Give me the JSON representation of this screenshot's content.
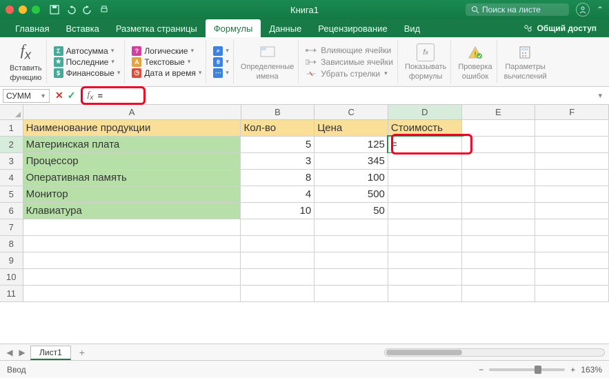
{
  "titlebar": {
    "title": "Книга1",
    "search_placeholder": "Поиск на листе"
  },
  "tabs": {
    "home": "Главная",
    "insert": "Вставка",
    "layout": "Разметка страницы",
    "formulas": "Формулы",
    "data": "Данные",
    "review": "Рецензирование",
    "view": "Вид",
    "share": "Общий доступ"
  },
  "ribbon": {
    "insert_fn": "Вставить",
    "insert_fn2": "функцию",
    "autosum": "Автосумма",
    "recent": "Последние",
    "financial": "Финансовые",
    "logical": "Логические",
    "text": "Текстовые",
    "datetime": "Дата и время",
    "defined": "Определенные",
    "names": "имена",
    "trace_prec": "Влияющие ячейки",
    "trace_dep": "Зависимые ячейки",
    "remove_arrows": "Убрать стрелки",
    "show_formulas": "Показывать",
    "show_formulas2": "формулы",
    "error_check": "Проверка",
    "error_check2": "ошибок",
    "calc_opts": "Параметры",
    "calc_opts2": "вычислений"
  },
  "formula_bar": {
    "name": "СУММ",
    "formula": "="
  },
  "columns": [
    "A",
    "B",
    "C",
    "D",
    "E",
    "F"
  ],
  "headers": {
    "A": "Наименование продукции",
    "B": "Кол-во",
    "C": "Цена",
    "D": "Стоимость"
  },
  "rows": [
    {
      "name": "Материнская плата",
      "qty": "5",
      "price": "125"
    },
    {
      "name": "Процессор",
      "qty": "3",
      "price": "345"
    },
    {
      "name": "Оперативная память",
      "qty": "8",
      "price": "100"
    },
    {
      "name": "Монитор",
      "qty": "4",
      "price": "500"
    },
    {
      "name": "Клавиатура",
      "qty": "10",
      "price": "50"
    }
  ],
  "editing": {
    "cell": "D2",
    "value": "="
  },
  "sheet": {
    "name": "Лист1"
  },
  "status": {
    "mode": "Ввод",
    "zoom": "163%"
  },
  "chart_data": {
    "type": "table",
    "columns": [
      "Наименование продукции",
      "Кол-во",
      "Цена",
      "Стоимость"
    ],
    "data": [
      [
        "Материнская плата",
        5,
        125,
        null
      ],
      [
        "Процессор",
        3,
        345,
        null
      ],
      [
        "Оперативная память",
        8,
        100,
        null
      ],
      [
        "Монитор",
        4,
        500,
        null
      ],
      [
        "Клавиатура",
        10,
        50,
        null
      ]
    ]
  }
}
